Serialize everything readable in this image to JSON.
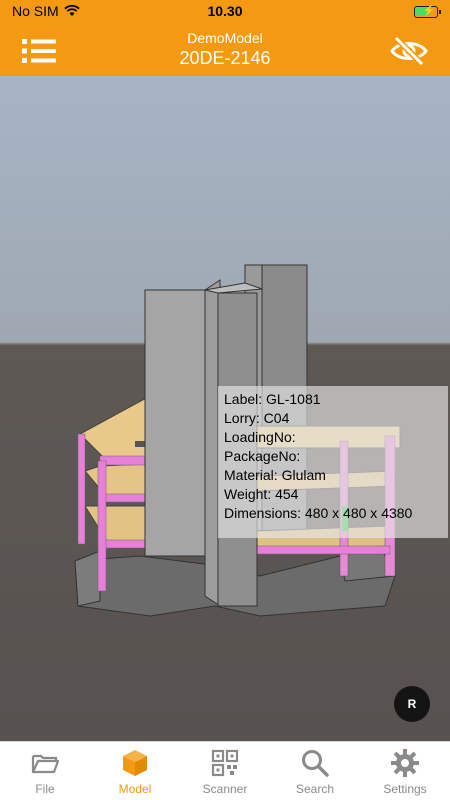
{
  "status_bar": {
    "carrier": "No SIM",
    "time": "10.30",
    "battery_level": 0.7
  },
  "header": {
    "title": "DemoModel",
    "subtitle": "20DE-2146"
  },
  "info_box": {
    "label": "Label: GL-1081",
    "lorry": "Lorry: C04",
    "loading_no": "LoadingNo:",
    "package_no": "PackageNo:",
    "material": "Material: Glulam",
    "weight": "Weight: 454",
    "dimensions": "Dimensions: 480 x 480 x 4380"
  },
  "reset_button": {
    "label": "R"
  },
  "tabs": [
    {
      "label": "File",
      "icon": "folder-icon",
      "active": false
    },
    {
      "label": "Model",
      "icon": "cube-icon",
      "active": true
    },
    {
      "label": "Scanner",
      "icon": "qr-code-icon",
      "active": false
    },
    {
      "label": "Search",
      "icon": "search-icon",
      "active": false
    },
    {
      "label": "Settings",
      "icon": "gear-icon",
      "active": false
    }
  ],
  "colors": {
    "accent": "#f39a12",
    "inactive": "#8a8a8a",
    "highlight": "#e3232b",
    "beam": "#e87fd8"
  }
}
